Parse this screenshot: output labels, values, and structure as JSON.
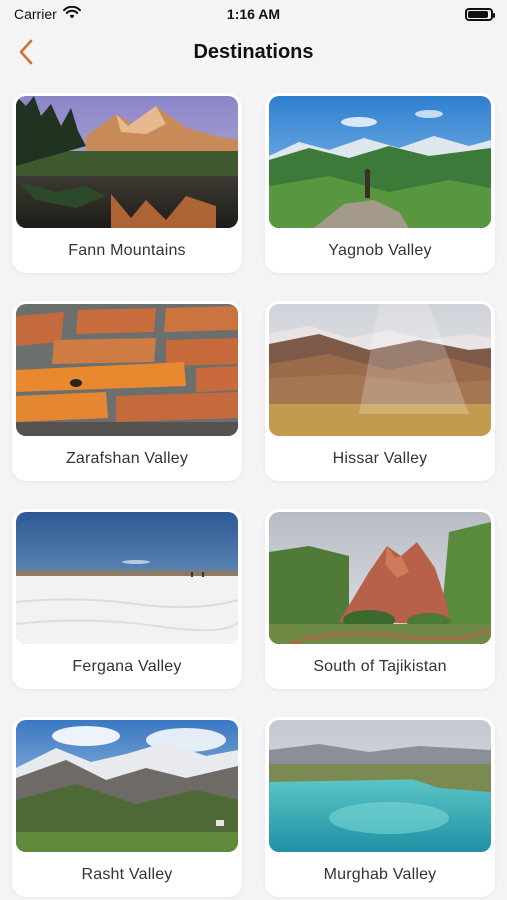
{
  "status": {
    "carrier": "Carrier",
    "time": "1:16 AM"
  },
  "nav": {
    "title": "Destinations",
    "accent": "#d4702a"
  },
  "destinations": [
    {
      "label": "Fann Mountains",
      "image": "mountain-lake-reflection"
    },
    {
      "label": "Yagnob Valley",
      "image": "green-mountain-valley"
    },
    {
      "label": "Zarafshan Valley",
      "image": "orange-lichen-stones"
    },
    {
      "label": "Hissar Valley",
      "image": "autumn-hillside"
    },
    {
      "label": "Fergana Valley",
      "image": "salt-flat"
    },
    {
      "label": "South of Tajikistan",
      "image": "red-rock-formation"
    },
    {
      "label": "Rasht Valley",
      "image": "snowy-peaks-valley"
    },
    {
      "label": "Murghab Valley",
      "image": "turquoise-lake"
    }
  ]
}
